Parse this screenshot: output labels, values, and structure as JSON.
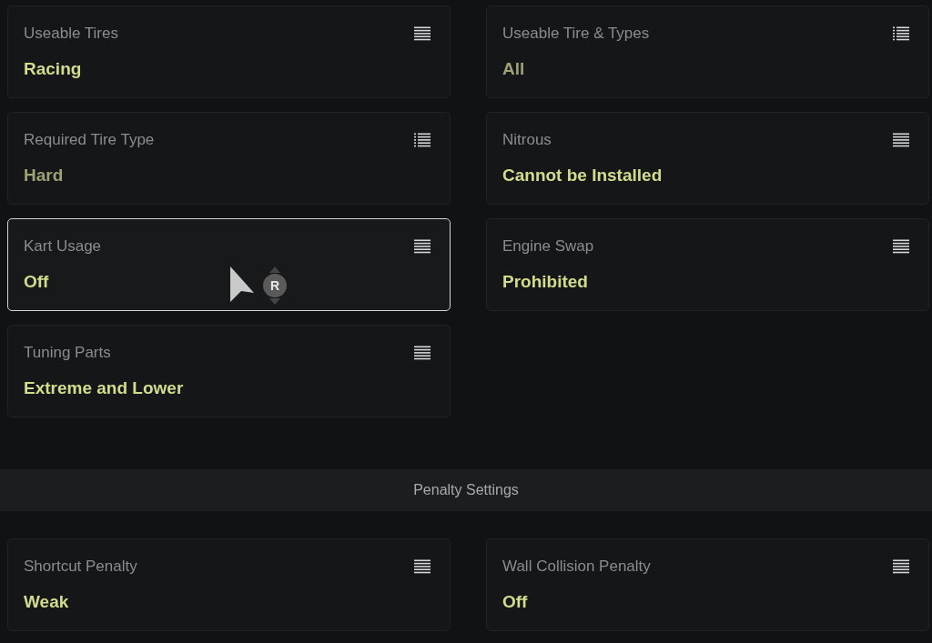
{
  "settings": [
    {
      "label": "Useable Tires",
      "value": "Racing",
      "kind": "select",
      "disabled": false,
      "selected": false
    },
    {
      "label": "Useable Tire & Types",
      "value": "All",
      "kind": "multi",
      "disabled": true,
      "selected": false
    },
    {
      "label": "Required Tire Type",
      "value": "Hard",
      "kind": "multi",
      "disabled": true,
      "selected": false
    },
    {
      "label": "Nitrous",
      "value": "Cannot be Installed",
      "kind": "select",
      "disabled": false,
      "selected": false
    },
    {
      "label": "Kart Usage",
      "value": "Off",
      "kind": "select",
      "disabled": false,
      "selected": true
    },
    {
      "label": "Engine Swap",
      "value": "Prohibited",
      "kind": "select",
      "disabled": false,
      "selected": false
    },
    {
      "label": "Tuning Parts",
      "value": "Extreme and Lower",
      "kind": "select",
      "disabled": false,
      "selected": false
    }
  ],
  "cursor": {
    "button_label": "R"
  },
  "section": {
    "title": "Penalty Settings"
  },
  "penalty_settings": [
    {
      "label": "Shortcut Penalty",
      "value": "Weak",
      "kind": "select",
      "disabled": false,
      "selected": false
    },
    {
      "label": "Wall Collision Penalty",
      "value": "Off",
      "kind": "select",
      "disabled": false,
      "selected": false
    }
  ]
}
